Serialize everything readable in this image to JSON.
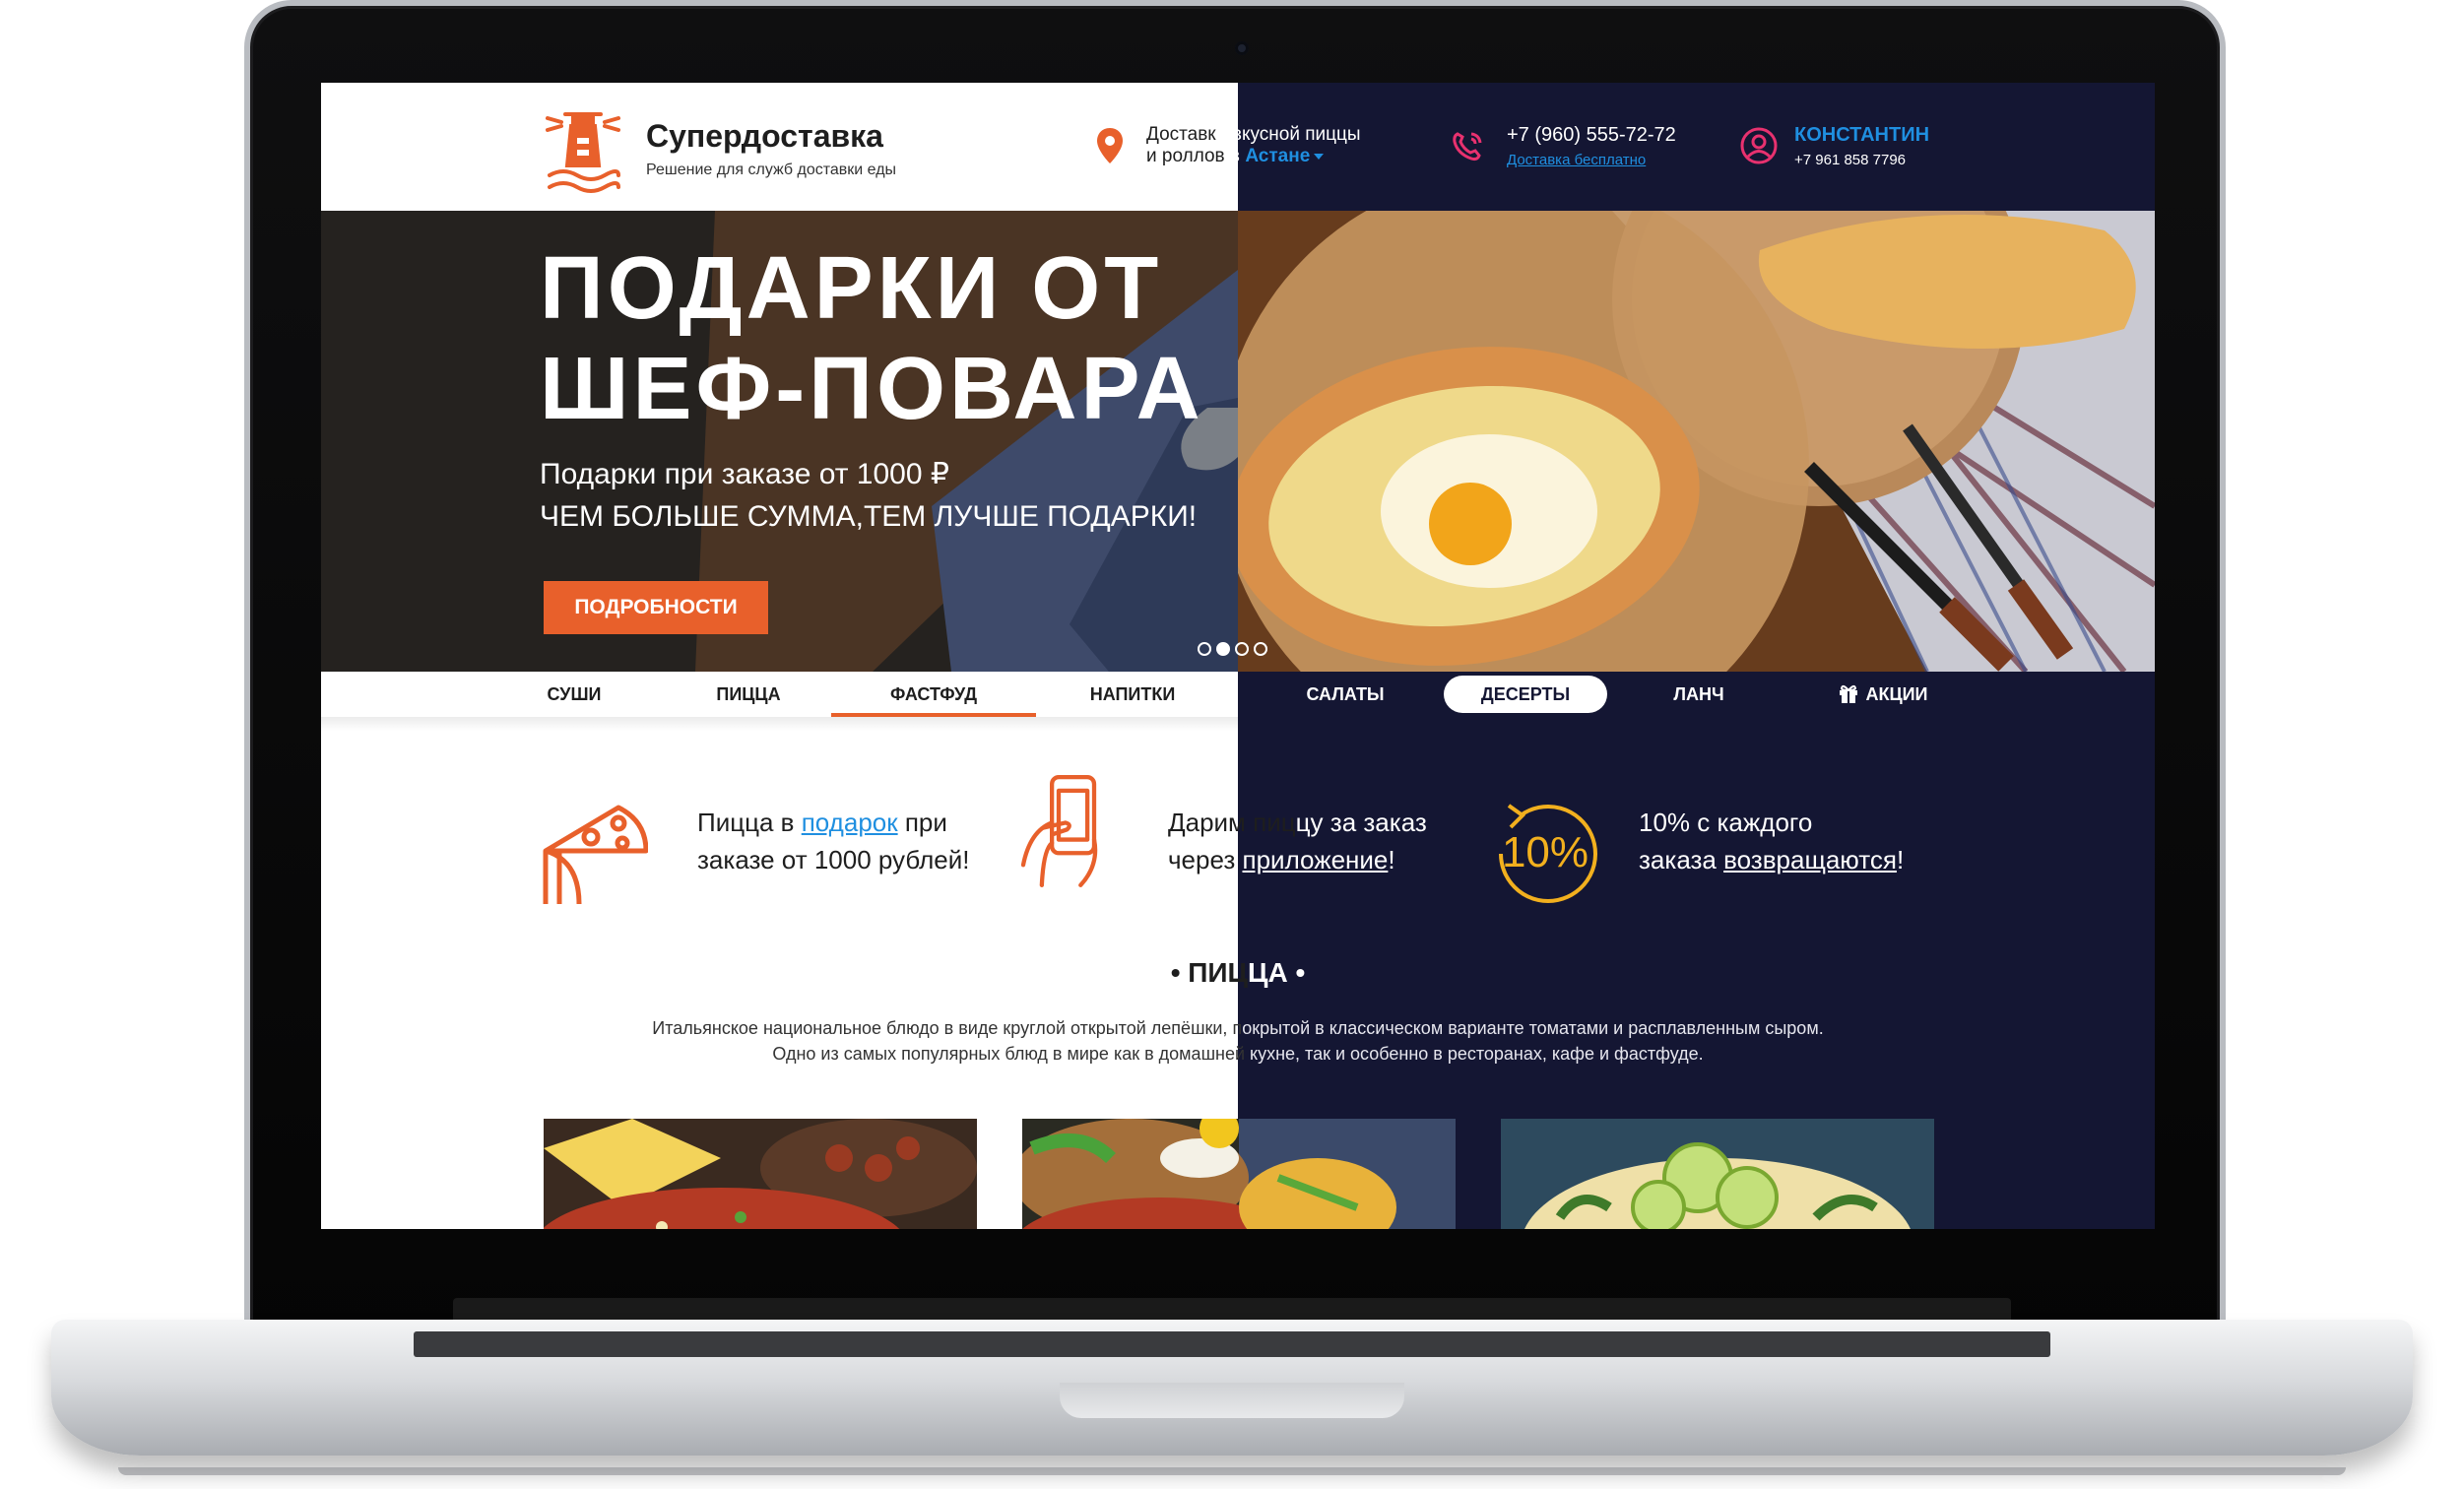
{
  "header": {
    "brand_name": "Супердоставка",
    "brand_tagline": "Решение для служб доставки еды",
    "delivery_line1": "Доставка вкусной пиццы",
    "delivery_line2": "и роллов в",
    "city": "Астане",
    "phone": "+7 (960) 555-72-72",
    "phone_note": "Доставка бесплатно",
    "user_name": "КОНСТАНТИН",
    "user_phone": "+7 961 858 7796"
  },
  "hero": {
    "title_line1": "ПОДАРКИ ОТ",
    "title_line2": "ШЕФ-ПОВАРА",
    "subtitle1": "Подарки при заказе от 1000 ₽",
    "subtitle2": "ЧЕМ БОЛЬШЕ СУММА,ТЕМ ЛУЧШЕ ПОДАРКИ!",
    "button_label": "ПОДРОБНОСТИ",
    "slides_total": 4,
    "slide_active": 2
  },
  "nav": {
    "items": [
      "СУШИ",
      "ПИЦЦА",
      "ФАСТФУД",
      "НАПИТКИ",
      "САЛАТЫ",
      "ДЕСЕРТЫ",
      "ЛАНЧ",
      "АКЦИИ"
    ]
  },
  "features": [
    {
      "pre": "Пицца в ",
      "link": "подарок",
      "post": " при",
      "line2": "заказе от 1000 рублей!"
    },
    {
      "line1": "Дарим пиццу за заказ",
      "pre2": "через ",
      "link": "приложение",
      "post2": "!"
    },
    {
      "badge": "10%",
      "line1": "10% с каждого",
      "pre2": "заказа ",
      "link": "возвращаются",
      "post2": "!"
    }
  ],
  "section": {
    "title": "• ПИЦЦА •",
    "desc1_left": "Итальянское национальное блюдо в виде круглой открытой лепёшки, п",
    "desc1_right": "окрытой в классическом варианте томатами и расплавленным сыром.",
    "desc2_left": "Одно из самых популярных блюд в мире как в домашней",
    "desc2_right": " кухне, так и особенно в ресторанах, кафе и фастфуде."
  },
  "colors": {
    "accent": "#e8602b",
    "dark_bg": "#141633",
    "link": "#1f8fe0",
    "gold": "#f2b01e",
    "pink": "#e8316f"
  },
  "icons": [
    "lighthouse-icon",
    "location-pin-icon",
    "phone-icon",
    "user-icon",
    "gift-icon",
    "pizza-slice-icon",
    "phone-in-hand-icon",
    "cashback-icon"
  ]
}
